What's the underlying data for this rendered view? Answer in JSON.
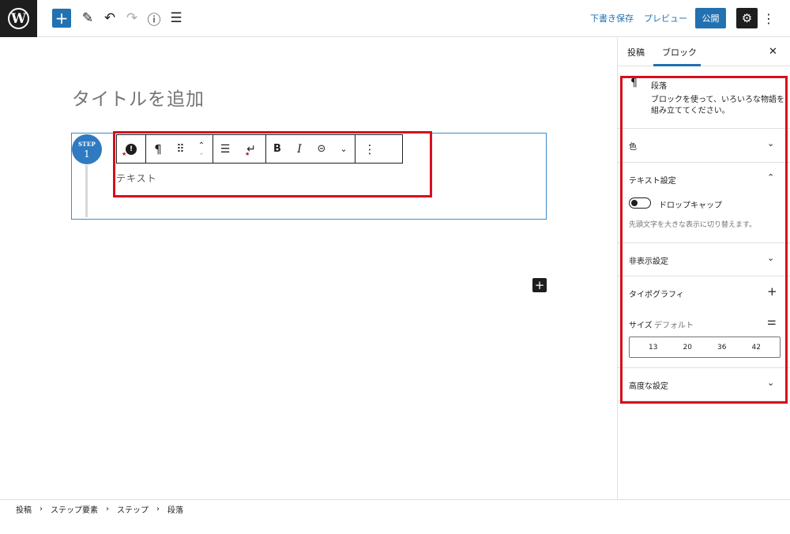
{
  "topbar": {
    "logo": "W",
    "inserter_icon": "+",
    "tools_icon": "✎",
    "undo_icon": "↶",
    "redo_icon": "↷",
    "info_icon": "ⓘ",
    "list_view_icon": "☰",
    "save_draft": "下書き保存",
    "preview": "プレビュー",
    "publish": "公開",
    "settings_icon": "⚙",
    "more_icon": "⋮"
  },
  "editor": {
    "title_placeholder": "タイトルを追加",
    "step": {
      "label": "STEP",
      "number": "1",
      "text": "テキスト"
    },
    "block_toolbar": {
      "parent_icon": "!",
      "parent_badge": "★",
      "paragraph_icon": "¶",
      "drag_icon": "⠿",
      "move_up_icon": "⌃",
      "move_down_icon": "⌄",
      "align_icon": "☰",
      "return_icon": "↵",
      "return_badge": "★",
      "bold": "B",
      "italic": "I",
      "link_icon": "⊝",
      "more_rich_icon": "⌄",
      "options_icon": "⋮"
    },
    "add_block_icon": "+"
  },
  "sidebar": {
    "tabs": {
      "post": "投稿",
      "block": "ブロック"
    },
    "close_icon": "✕",
    "block_card": {
      "icon": "¶",
      "title": "段落",
      "description": "ブロックを使って、いろいろな物語を組み立ててください。"
    },
    "panels": {
      "color": {
        "title": "色",
        "chevron": "⌄"
      },
      "text_settings": {
        "title": "テキスト設定",
        "chevron": "⌃",
        "drop_cap_label": "ドロップキャップ",
        "drop_cap_help": "先頭文字を大きな表示に切り替えます。"
      },
      "hidden_settings": {
        "title": "非表示設定",
        "chevron": "⌄"
      },
      "typography": {
        "title": "タイポグラフィ",
        "plus_icon": "+",
        "size_label": "サイズ",
        "size_value": "デフォルト",
        "custom_icon": "⚌",
        "sizes": [
          "13",
          "20",
          "36",
          "42"
        ]
      },
      "advanced": {
        "title": "高度な設定",
        "chevron": "⌄"
      }
    }
  },
  "footer": {
    "breadcrumbs": [
      "投稿",
      "ステップ要素",
      "ステップ",
      "段落"
    ],
    "separator": "›"
  },
  "colors": {
    "accent": "#2271b1",
    "highlight": "#d5101e",
    "step_circle": "#2f7ac0"
  }
}
